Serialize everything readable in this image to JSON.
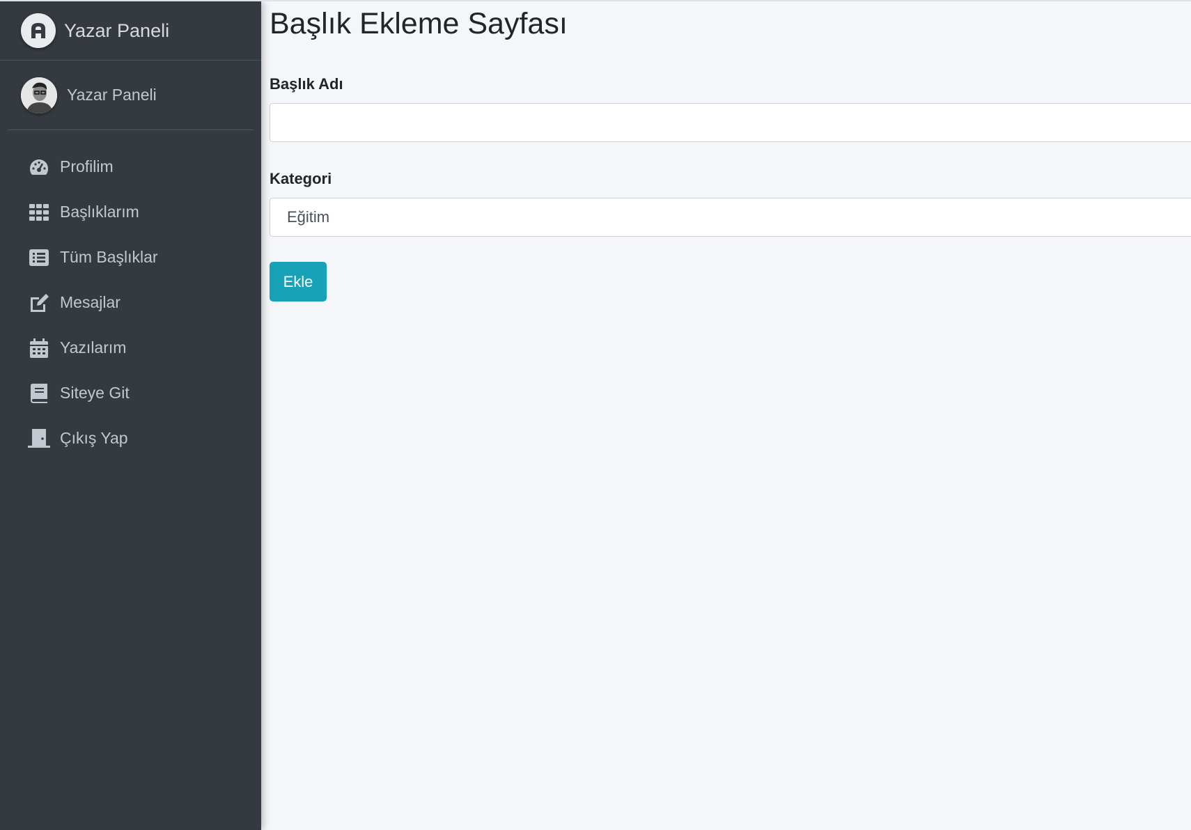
{
  "sidebar": {
    "brand_text": "Yazar Paneli",
    "user_name": "Yazar Paneli",
    "items": [
      {
        "label": "Profilim",
        "icon": "tachometer-icon"
      },
      {
        "label": "Başlıklarım",
        "icon": "grid-icon"
      },
      {
        "label": "Tüm Başlıklar",
        "icon": "list-icon"
      },
      {
        "label": "Mesajlar",
        "icon": "edit-icon"
      },
      {
        "label": "Yazılarım",
        "icon": "calendar-icon"
      },
      {
        "label": "Siteye Git",
        "icon": "book-icon"
      },
      {
        "label": "Çıkış Yap",
        "icon": "door-icon"
      }
    ]
  },
  "main": {
    "title": "Başlık Ekleme Sayfası",
    "title_field": {
      "label": "Başlık Adı",
      "value": ""
    },
    "category_field": {
      "label": "Kategori",
      "selected": "Eğitim"
    },
    "submit_label": "Ekle"
  },
  "colors": {
    "sidebar_bg": "#343a40",
    "content_bg": "#f4f6f9",
    "button_bg": "#17a2b8"
  }
}
